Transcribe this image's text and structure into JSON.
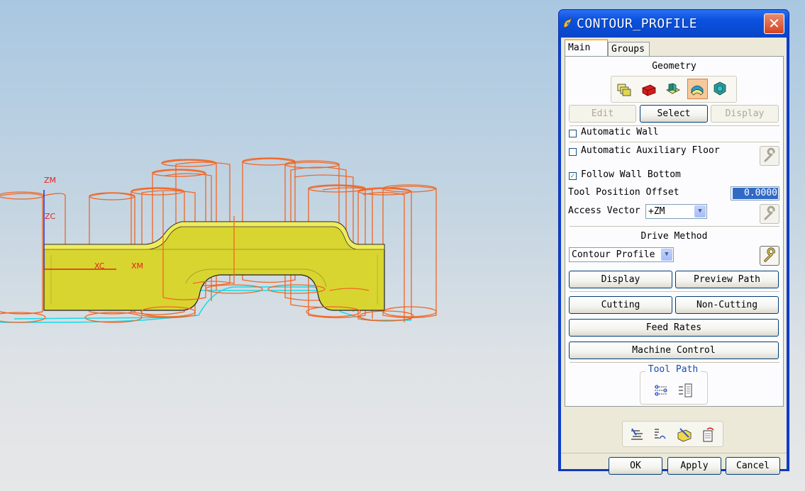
{
  "viewport": {
    "axis_labels": {
      "zm": "ZM",
      "zc": "ZC",
      "xc": "XC",
      "xm": "XM"
    },
    "colors": {
      "part": "#d8d530",
      "tool": "#f26522",
      "path": "#19d9e6",
      "axis_x": "#e0241f",
      "axis_z": "#2a2ee0"
    }
  },
  "dialog": {
    "title": "CONTOUR_PROFILE",
    "title_icon": "nx-operation-icon",
    "close_label": "✕",
    "tabs": [
      {
        "label": "Main",
        "active": true
      },
      {
        "label": "Groups",
        "active": false
      }
    ],
    "geometry": {
      "heading": "Geometry",
      "icons": [
        "part-geometry-icon",
        "blank-geometry-icon",
        "floor-geometry-icon",
        "wall-geometry-icon",
        "check-geometry-icon"
      ],
      "edit_label": "Edit",
      "select_label": "Select",
      "display_label": "Display"
    },
    "automatic_wall": {
      "label": "Automatic Wall",
      "checked": false
    },
    "automatic_aux_floor": {
      "label": "Automatic Auxiliary Floor",
      "checked": false
    },
    "follow_wall_bottom": {
      "label": "Follow Wall Bottom",
      "checked": true
    },
    "tool_position_offset": {
      "label": "Tool Position Offset",
      "value": "0.0000"
    },
    "access_vector": {
      "label": "Access Vector",
      "value": "+ZM"
    },
    "drive_method": {
      "heading": "Drive Method",
      "value": "Contour Profile"
    },
    "buttons": {
      "display": "Display",
      "preview_path": "Preview Path",
      "cutting": "Cutting",
      "non_cutting": "Non-Cutting",
      "feed_rates": "Feed Rates",
      "machine_control": "Machine Control"
    },
    "tool_path": {
      "heading": "Tool Path"
    },
    "footer": {
      "ok": "OK",
      "apply": "Apply",
      "cancel": "Cancel"
    }
  }
}
